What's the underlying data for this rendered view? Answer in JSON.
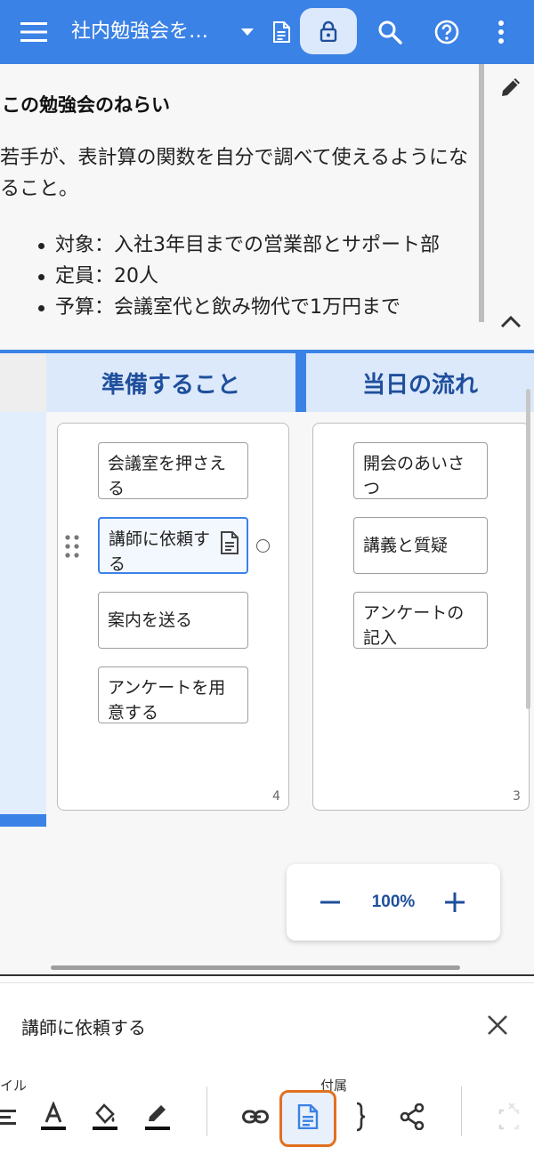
{
  "appbar": {
    "title": "社内勉強会を…",
    "menu_icon": "hamburger-menu-icon",
    "icons": [
      "dropdown-arrow-icon",
      "document-icon",
      "lock-icon",
      "search-icon",
      "help-icon",
      "more-vert-icon"
    ],
    "accent": "#3b82e6"
  },
  "note": {
    "heading": "この勉強会のねらい",
    "paragraph": "若手が、表計算の関数を自分で調べて使えるようになること。",
    "bullets": [
      "対象：入社3年目までの営業部とサポート部",
      "定員：20人",
      "予算：会議室代と飲み物代で1万円まで"
    ]
  },
  "board": {
    "columns": [
      {
        "title": "準備すること",
        "count": "4",
        "cards": [
          "会議室を押さえる",
          "講師に依頼する",
          "案内を送る",
          "アンケートを用意する"
        ]
      },
      {
        "title": "当日の流れ",
        "count": "3",
        "cards": [
          "開会のあいさつ",
          "講義と質疑",
          "アンケートの記入"
        ]
      }
    ],
    "selected_card": "講師に依頼する",
    "header_color": "#dce9fb",
    "header_text_color": "#1f4f9c"
  },
  "zoom": {
    "value": "100%",
    "minus": "−",
    "plus": "+"
  },
  "sheet": {
    "selected_item": "講師に依頼する",
    "section_style": "イル",
    "section_attach": "付属",
    "tools": [
      "align-icon",
      "text-color-icon",
      "fill-color-icon",
      "pen-icon",
      "link-icon",
      "attach-document-icon",
      "brace-icon",
      "share-icon",
      "fullscreen-icon"
    ],
    "highlight_color": "#e07020"
  }
}
